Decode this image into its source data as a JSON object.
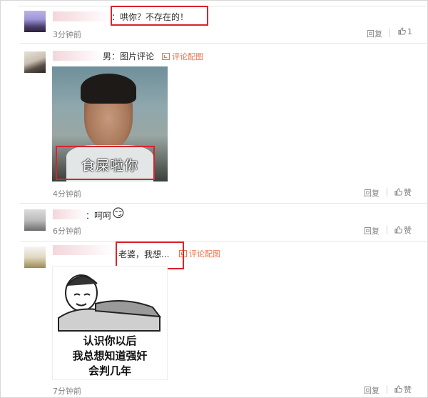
{
  "comments": [
    {
      "text": "：哄你？不存在的！",
      "time": "3分钟前",
      "reply": "回复",
      "likes": "1",
      "thumb_icon": "thumbs-up-icon"
    },
    {
      "text": "男：图片评论",
      "pic_link": "评论配图",
      "image_caption": "食屎啦你",
      "time": "4分钟前",
      "reply": "回复",
      "likes": "赞",
      "thumb_icon": "thumbs-up-icon"
    },
    {
      "text": "：呵呵",
      "emoji": "😏",
      "time": "6分钟前",
      "reply": "回复",
      "likes": "赞",
      "thumb_icon": "thumbs-up-icon"
    },
    {
      "text": "老婆，我想...",
      "pic_link": "评论配图",
      "image_caption_lines": [
        "认识你以后",
        "我总想知道强奸",
        "会判几年"
      ],
      "time": "7分钟前",
      "reply": "回复",
      "likes": "赞",
      "thumb_icon": "thumbs-up-icon"
    }
  ],
  "colors": {
    "highlight_box": "#d9232e",
    "link": "#eb7350",
    "meta_text": "#808080"
  }
}
